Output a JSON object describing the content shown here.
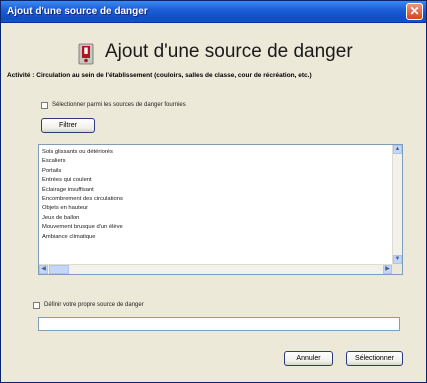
{
  "window": {
    "title": "Ajout d'une source de danger",
    "close_symbol": "✕"
  },
  "header": {
    "title": "Ajout d'une source de danger",
    "icon": "warning-sign-icon"
  },
  "activity_line": "Activité : Circulation au sein de l'établissement (couloirs, salles de classe, cour de récréation, etc.)",
  "filter_section": {
    "checkbox_label": "Sélectionner parmi les sources de danger fournies",
    "checked": false,
    "filter_button": "Filtrer"
  },
  "list": {
    "items": [
      "Sols glissants ou détériorés",
      "Escaliers",
      "Portails",
      "Entrées qui coulent",
      "Éclairage insuffisant",
      "Encombrement des circulations",
      "Objets en hauteur",
      "Jeux de ballon",
      "Mouvement brusque d'un élève",
      "Ambiance climatique"
    ]
  },
  "other_section": {
    "checkbox_label": "Définir votre propre source de danger",
    "checked": false,
    "input_value": ""
  },
  "buttons": {
    "cancel": "Annuler",
    "select": "Sélectionner"
  }
}
